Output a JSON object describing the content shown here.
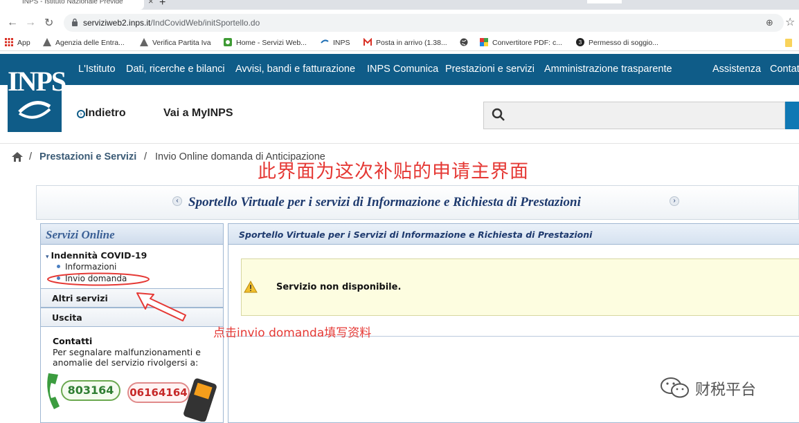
{
  "browser": {
    "tab_title": "INPS - Istituto Nazionale Previde",
    "url_host": "serviziweb2.inps.it",
    "url_path": "/IndCovidWeb/initSportello.do",
    "bookmarks": [
      "App",
      "Agenzia delle Entra...",
      "Verifica Partita Iva",
      "Home - Servizi Web...",
      "INPS",
      "Posta in arrivo (1.38...",
      "Convertitore PDF: c...",
      "Permesso di soggio..."
    ]
  },
  "header": {
    "nav": [
      "L'Istituto",
      "Dati, ricerche e bilanci",
      "Avvisi, bandi e fatturazione",
      "INPS Comunica",
      "Prestazioni e servizi",
      "Amministrazione trasparente",
      "Assistenza",
      "Contat"
    ],
    "logo": "INPS",
    "back_label": "Indietro",
    "myinps_label": "Vai a MyINPS"
  },
  "breadcrumb": {
    "level1": "Prestazioni e Servizi",
    "level2": "Invio Online domanda di Anticipazione"
  },
  "sportello": {
    "title": "Sportello Virtuale per i servizi di Informazione e Richiesta di Prestazioni"
  },
  "sidebar": {
    "header": "Servizi Online",
    "group_title": "Indennità COVID-19",
    "links": [
      "Informazioni",
      "Invio domanda"
    ],
    "rows": [
      "Altri servizi",
      "Uscita"
    ],
    "contacts_title": "Contatti",
    "contacts_desc": "Per segnalare malfunzionamenti e anomalie del servizio rivolgersi a:",
    "phone_green": "803164",
    "phone_red": "06164164"
  },
  "main": {
    "header": "Sportello Virtuale per i Servizi di Informazione e Richiesta di Prestazioni",
    "notice": "Servizio non disponibile."
  },
  "annotations": {
    "top": "此界面为这次补贴的申请主界面",
    "bottom": "点击invio domanda填写资料",
    "watermark": "财税平台"
  },
  "colors": {
    "brand": "#0f5c88",
    "annotation": "#e53935"
  }
}
